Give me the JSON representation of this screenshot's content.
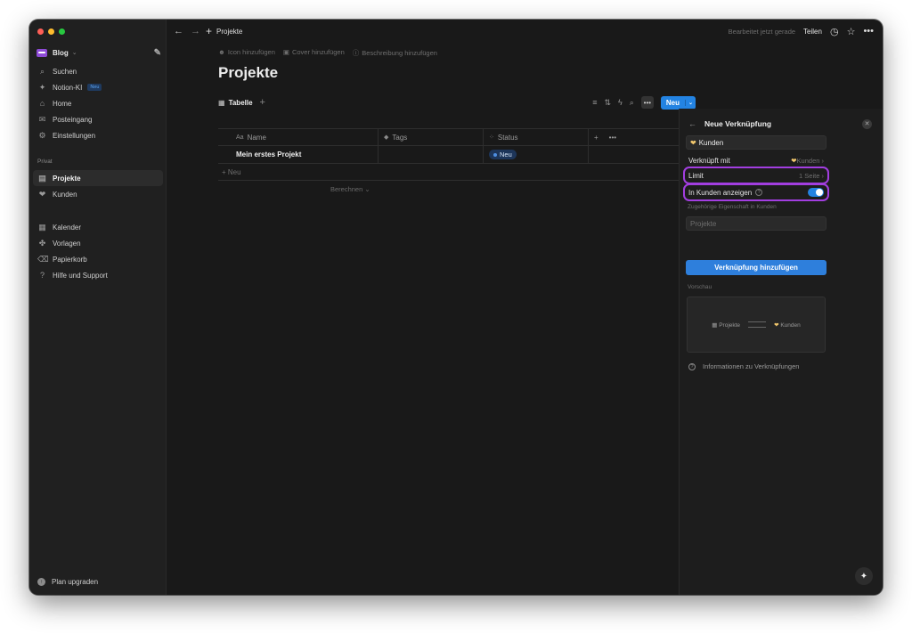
{
  "sidebar": {
    "workspace": "Blog",
    "items_top": [
      {
        "label": "Suchen",
        "icon": "search-icon",
        "glyph": "⌕"
      },
      {
        "label": "Notion-KI",
        "icon": "sparkle-icon",
        "glyph": "✦",
        "badge": "Neu"
      },
      {
        "label": "Home",
        "icon": "home-icon",
        "glyph": "⌂"
      },
      {
        "label": "Posteingang",
        "icon": "inbox-icon",
        "glyph": "✉"
      },
      {
        "label": "Einstellungen",
        "icon": "gear-icon",
        "glyph": "⚙"
      }
    ],
    "section_label": "Privat",
    "items_private": [
      {
        "label": "Projekte",
        "icon": "page-icon",
        "glyph": "▤"
      },
      {
        "label": "Kunden",
        "icon": "handshake-icon",
        "glyph": "❤"
      }
    ],
    "items_bottom": [
      {
        "label": "Kalender",
        "icon": "calendar-icon",
        "glyph": "▦"
      },
      {
        "label": "Vorlagen",
        "icon": "templates-icon",
        "glyph": "✤"
      },
      {
        "label": "Papierkorb",
        "icon": "trash-icon",
        "glyph": "🗑"
      },
      {
        "label": "Hilfe und Support",
        "icon": "help-icon",
        "glyph": "?"
      }
    ],
    "upgrade": "Plan upgraden"
  },
  "topbar": {
    "breadcrumb": "Projekte",
    "edited": "Bearbeitet jetzt gerade",
    "share": "Teilen"
  },
  "page": {
    "actions": [
      "Icon hinzufügen",
      "Cover hinzufügen",
      "Beschreibung hinzufügen"
    ],
    "title": "Projekte",
    "view_tab": "Tabelle",
    "new_button": "Neu"
  },
  "table": {
    "columns": [
      {
        "label": "Name",
        "prefix": "Aa"
      },
      {
        "label": "Tags",
        "prefix": ""
      },
      {
        "label": "Status",
        "prefix": ""
      }
    ],
    "rows": [
      {
        "name": "Mein erstes Projekt",
        "tags": "",
        "status": "Neu"
      }
    ],
    "add_row": "+ Neu",
    "calculate": "Berechnen ⌄"
  },
  "panel": {
    "title": "Neue Verknüpfung",
    "target": "Kunden",
    "linked_with_label": "Verknüpft mit",
    "linked_with_value": "Kunden",
    "limit_label": "Limit",
    "limit_value": "1 Seite",
    "show_in_label": "In Kunden anzeigen",
    "show_in_enabled": true,
    "related_prop_label": "Zugehörige Eigenschaft in Kunden",
    "related_prop_placeholder": "Projekte",
    "add_button": "Verknüpfung hinzufügen",
    "preview_label": "Vorschau",
    "preview_left": "Projekte",
    "preview_right": "Kunden",
    "info": "Informationen zu Verknüpfungen"
  },
  "colors": {
    "accent": "#2383e2",
    "highlight": "#a23ee0",
    "background": "#191919"
  }
}
